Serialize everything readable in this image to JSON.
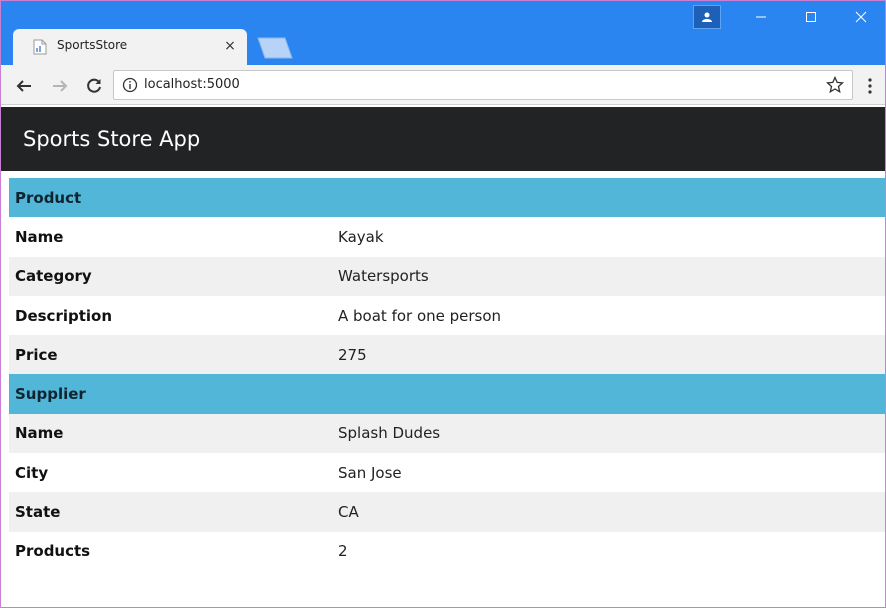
{
  "browser": {
    "tab_title": "SportsStore",
    "tab_close": "×",
    "url": "localhost:5000"
  },
  "page": {
    "brand": "Sports Store App",
    "product": {
      "header": "Product",
      "rows": [
        {
          "label": "Name",
          "value": "Kayak"
        },
        {
          "label": "Category",
          "value": "Watersports"
        },
        {
          "label": "Description",
          "value": "A boat for one person"
        },
        {
          "label": "Price",
          "value": "275"
        }
      ]
    },
    "supplier": {
      "header": "Supplier",
      "rows": [
        {
          "label": "Name",
          "value": "Splash Dudes"
        },
        {
          "label": "City",
          "value": "San Jose"
        },
        {
          "label": "State",
          "value": "CA"
        },
        {
          "label": "Products",
          "value": "2"
        }
      ]
    }
  },
  "colors": {
    "titlebar": "#2b85f0",
    "navbar": "#212325",
    "section_header": "#51b6d8",
    "stripe": "#f0f0f0"
  }
}
